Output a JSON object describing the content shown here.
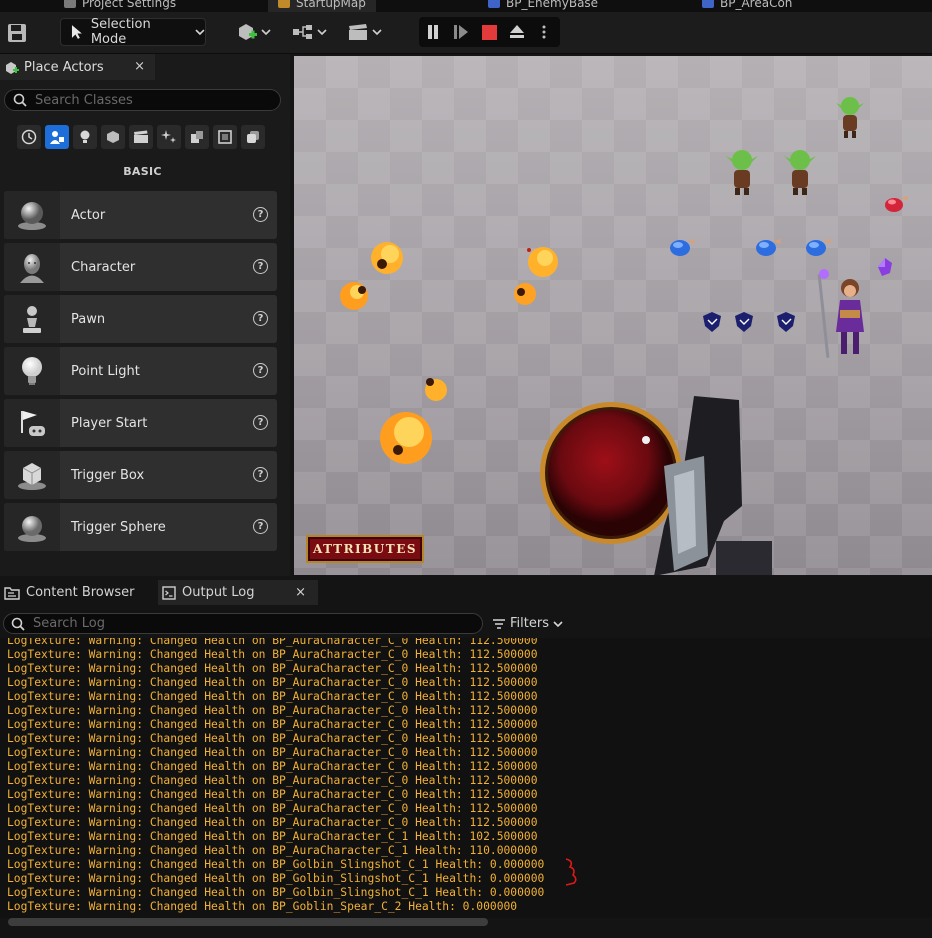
{
  "tabs": {
    "items": [
      {
        "label": "Project Settings"
      },
      {
        "label": "StartupMap"
      },
      {
        "label": "BP_EnemyBase"
      },
      {
        "label": "BP_AreaCon"
      }
    ]
  },
  "toolbar": {
    "mode_label": "Selection Mode"
  },
  "place_actors": {
    "tab_label": "Place Actors",
    "close_glyph": "×",
    "search_placeholder": "Search Classes",
    "category_label": "BASIC",
    "categories": [
      "recent-icon",
      "basic-icon",
      "lights-icon",
      "shapes-icon",
      "cinematic-icon",
      "visual-effects-icon",
      "geometry-icon",
      "volumes-icon",
      "all-classes-icon"
    ],
    "items": [
      {
        "label": "Actor",
        "icon": "sphere-icon"
      },
      {
        "label": "Character",
        "icon": "character-icon"
      },
      {
        "label": "Pawn",
        "icon": "pawn-icon"
      },
      {
        "label": "Point Light",
        "icon": "light-bulb-icon"
      },
      {
        "label": "Player Start",
        "icon": "player-start-icon"
      },
      {
        "label": "Trigger Box",
        "icon": "trigger-box-icon"
      },
      {
        "label": "Trigger Sphere",
        "icon": "trigger-sphere-icon"
      }
    ],
    "help_glyph": "?"
  },
  "viewport": {
    "hud_button_label": "ATTRIBUTES"
  },
  "bottom": {
    "tabs": [
      {
        "label": "Content Browser"
      },
      {
        "label": "Output Log"
      }
    ],
    "close_glyph": "×",
    "search_placeholder": "Search Log",
    "filters_label": "Filters",
    "log_lines": [
      "LogTexture: Warning: Changed Health on BP_AuraCharacter_C_0 Health: 112.500000",
      "LogTexture: Warning: Changed Health on BP_AuraCharacter_C_0 Health: 112.500000",
      "LogTexture: Warning: Changed Health on BP_AuraCharacter_C_0 Health: 112.500000",
      "LogTexture: Warning: Changed Health on BP_AuraCharacter_C_0 Health: 112.500000",
      "LogTexture: Warning: Changed Health on BP_AuraCharacter_C_0 Health: 112.500000",
      "LogTexture: Warning: Changed Health on BP_AuraCharacter_C_0 Health: 112.500000",
      "LogTexture: Warning: Changed Health on BP_AuraCharacter_C_0 Health: 112.500000",
      "LogTexture: Warning: Changed Health on BP_AuraCharacter_C_0 Health: 112.500000",
      "LogTexture: Warning: Changed Health on BP_AuraCharacter_C_0 Health: 112.500000",
      "LogTexture: Warning: Changed Health on BP_AuraCharacter_C_0 Health: 112.500000",
      "LogTexture: Warning: Changed Health on BP_AuraCharacter_C_0 Health: 112.500000",
      "LogTexture: Warning: Changed Health on BP_AuraCharacter_C_0 Health: 112.500000",
      "LogTexture: Warning: Changed Health on BP_AuraCharacter_C_0 Health: 112.500000",
      "LogTexture: Warning: Changed Health on BP_AuraCharacter_C_0 Health: 112.500000",
      "LogTexture: Warning: Changed Health on BP_AuraCharacter_C_1 Health: 102.500000",
      "LogTexture: Warning: Changed Health on BP_AuraCharacter_C_1 Health: 110.000000",
      "LogTexture: Warning: Changed Health on BP_Golbin_Slingshot_C_1 Health: 0.000000",
      "LogTexture: Warning: Changed Health on BP_Golbin_Slingshot_C_1 Health: 0.000000",
      "LogTexture: Warning: Changed Health on BP_Golbin_Slingshot_C_1 Health: 0.000000",
      "LogTexture: Warning: Changed Health on BP_Goblin_Spear_C_2 Health: 0.000000"
    ]
  },
  "colors": {
    "log_warning": "#f2b134",
    "accent": "#1d6ed8",
    "stop_red": "#e33b3b"
  }
}
